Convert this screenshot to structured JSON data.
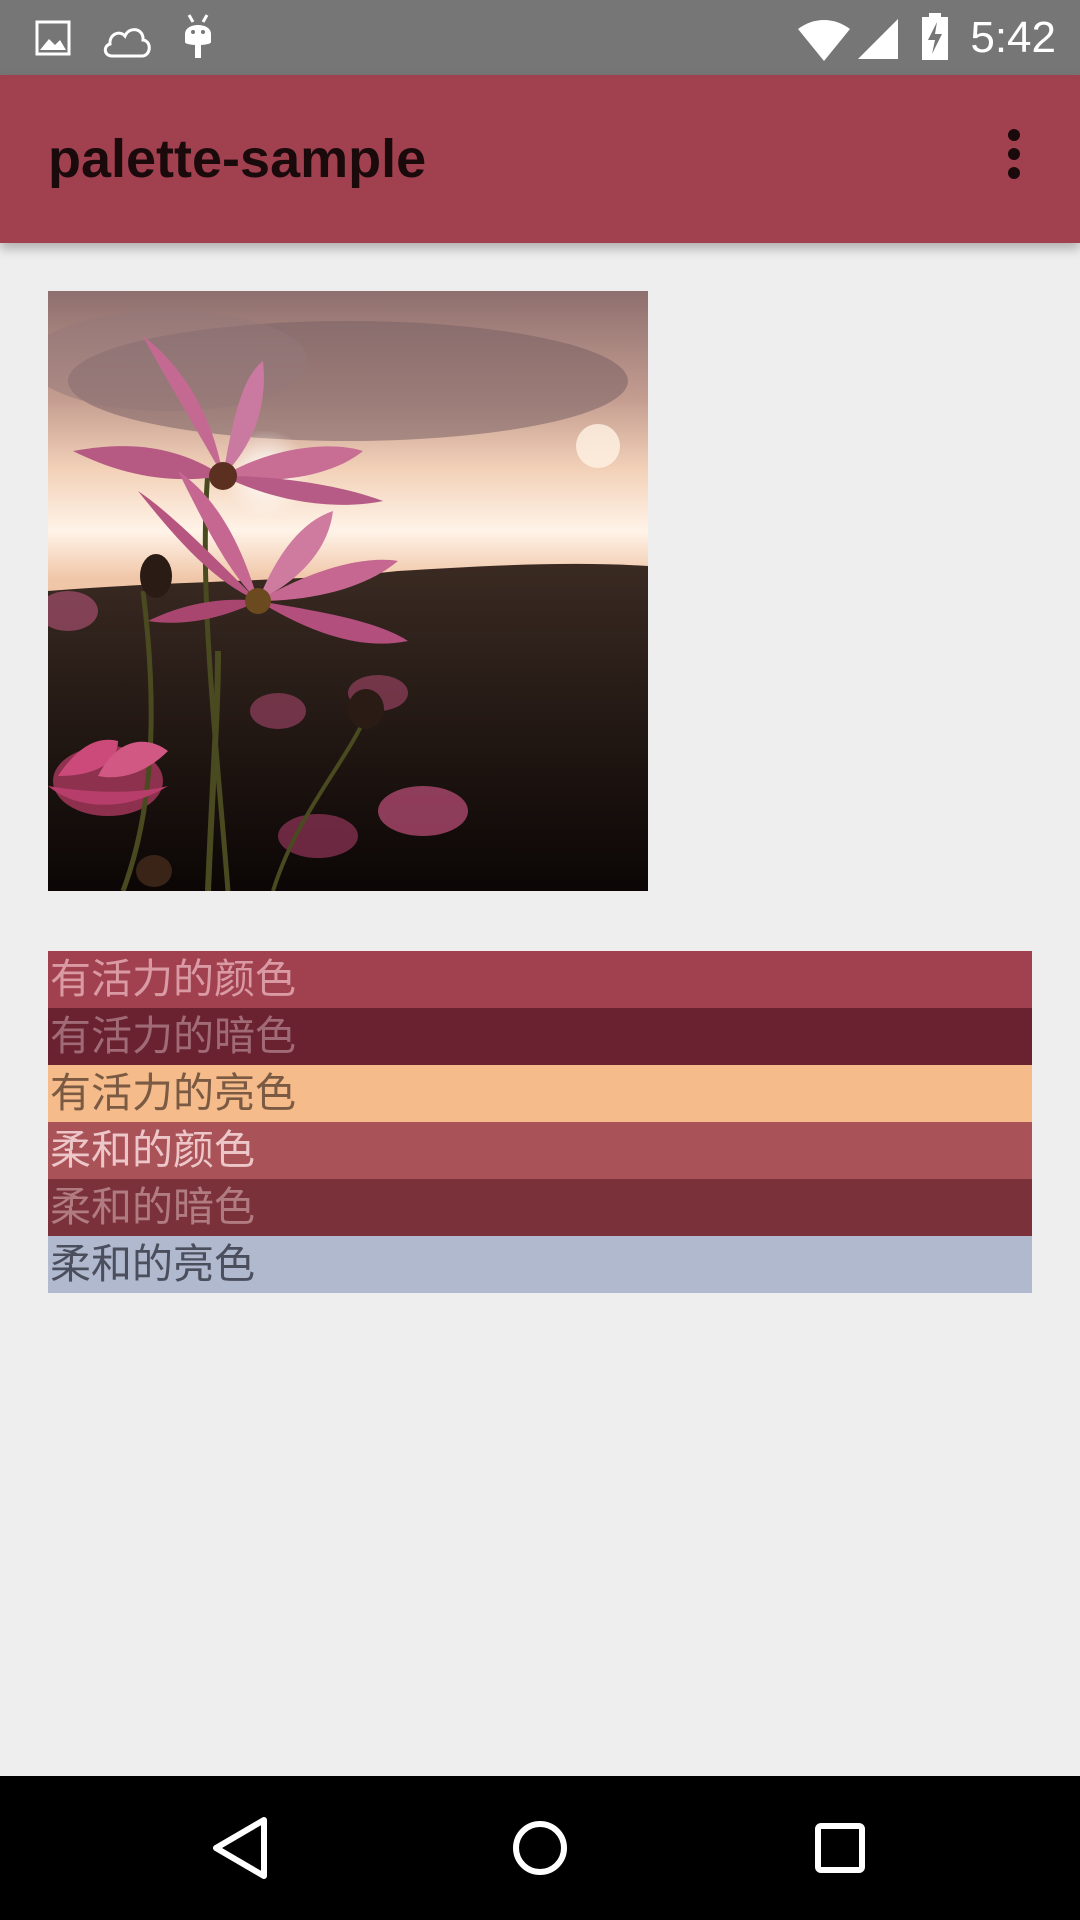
{
  "status_bar": {
    "time": "5:42",
    "left_icons": [
      "image-icon",
      "cloud-icon",
      "android-debug-icon"
    ],
    "right_icons": [
      "wifi-icon",
      "cell-signal-icon",
      "battery-charging-icon"
    ]
  },
  "app_bar": {
    "title": "palette-sample",
    "overflow_icon": "more-vert-icon",
    "color": "#a1414f"
  },
  "image": {
    "icon": "flower-photo"
  },
  "swatches": [
    {
      "label": "有活力的颜色",
      "bg": "#a1414f",
      "text": "#d99aa3"
    },
    {
      "label": "有活力的暗色",
      "bg": "#6a2231",
      "text": "#a06a76"
    },
    {
      "label": "有活力的亮色",
      "bg": "#f5bb8a",
      "text": "#7b5a43"
    },
    {
      "label": "柔和的颜色",
      "bg": "#a95257",
      "text": "#ecc6c8"
    },
    {
      "label": "柔和的暗色",
      "bg": "#7b313a",
      "text": "#b07c82"
    },
    {
      "label": "柔和的亮色",
      "bg": "#b1b9cf",
      "text": "#4b4e5c"
    }
  ],
  "nav_bar": {
    "icons": [
      "back-icon",
      "home-icon",
      "recents-icon"
    ]
  }
}
